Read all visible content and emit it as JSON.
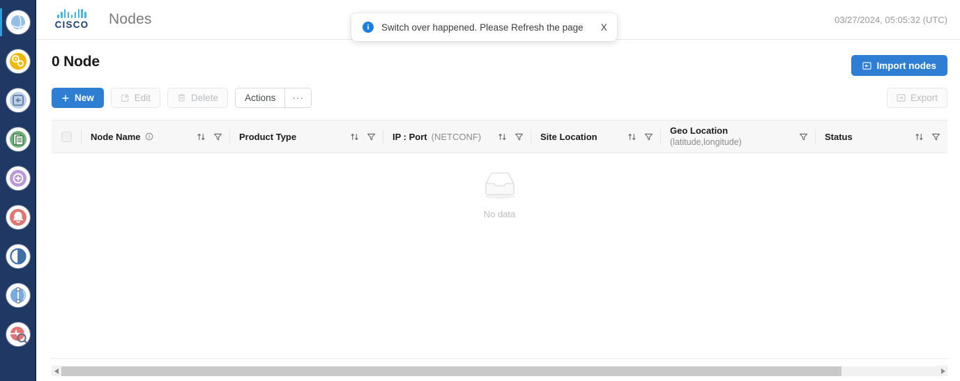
{
  "sidebar": {
    "items": [
      {
        "name": "globe-icon",
        "label": "Dashboard",
        "color": "#6fa8dc",
        "active": true
      },
      {
        "name": "gears-icon",
        "label": "Provisioning",
        "color": "#f2b705",
        "active": false
      },
      {
        "name": "device-config-icon",
        "label": "Device Configuration",
        "color": "#8fb6e3",
        "active": false
      },
      {
        "name": "documents-icon",
        "label": "Inventory",
        "color": "#5aa469",
        "active": false
      },
      {
        "name": "add-circle-icon",
        "label": "Onboarding",
        "color": "#9b6fc7",
        "active": false
      },
      {
        "name": "alarm-bell-icon",
        "label": "Alarms",
        "color": "#d9534f",
        "active": false
      },
      {
        "name": "half-circle-icon",
        "label": "Performance",
        "color": "#3f6fa8",
        "active": false
      },
      {
        "name": "topology-icon",
        "label": "Topology",
        "color": "#4a90d9",
        "active": false
      },
      {
        "name": "monitor-search-icon",
        "label": "Monitoring",
        "color": "#e05b5b",
        "active": false
      }
    ]
  },
  "header": {
    "brand_word": "CISCO",
    "title": "Nodes",
    "timestamp": "03/27/2024, 05:05:32 (UTC)"
  },
  "toast": {
    "icon": "info-icon",
    "badge": "i",
    "message": "Switch over happened. Please Refresh the page",
    "close_label": "X"
  },
  "page": {
    "title": "0 Node"
  },
  "toolbar": {
    "new_label": "New",
    "new_icon": "plus-icon",
    "edit_label": "Edit",
    "edit_icon": "pencil-square-icon",
    "delete_label": "Delete",
    "delete_icon": "trash-icon",
    "actions_label": "Actions",
    "overflow_label": "···",
    "import_label": "Import nodes",
    "import_icon": "import-icon",
    "export_label": "Export",
    "export_icon": "export-icon"
  },
  "table": {
    "columns": [
      {
        "key": "select",
        "label": "",
        "type": "checkbox",
        "sortable": false,
        "filterable": false
      },
      {
        "key": "node_name",
        "label": "Node Name",
        "sub": "",
        "info": true,
        "sortable": true,
        "filterable": true
      },
      {
        "key": "product_type",
        "label": "Product Type",
        "sub": "",
        "info": false,
        "sortable": true,
        "filterable": true
      },
      {
        "key": "ip_port",
        "label": "IP : Port",
        "sub": "(NETCONF)",
        "info": false,
        "sortable": true,
        "filterable": true
      },
      {
        "key": "site_location",
        "label": "Site Location",
        "sub": "",
        "info": false,
        "sortable": true,
        "filterable": true
      },
      {
        "key": "geo_location",
        "label": "Geo Location",
        "sub": "(latitude,longitude)",
        "info": false,
        "sortable": false,
        "filterable": true
      },
      {
        "key": "status",
        "label": "Status",
        "sub": "",
        "info": false,
        "sortable": true,
        "filterable": true
      }
    ],
    "rows": [],
    "empty_text": "No data",
    "empty_icon": "empty-inbox-icon"
  },
  "colors": {
    "accent": "#2e7fd4",
    "sidebar_bg": "#203864",
    "brand_cisco": "#1b3f73",
    "brand_bars": "#41b6e6",
    "toast_info": "#1f7de0",
    "header_bg": "#f7f7f8",
    "muted_text": "#8b8b8b"
  }
}
